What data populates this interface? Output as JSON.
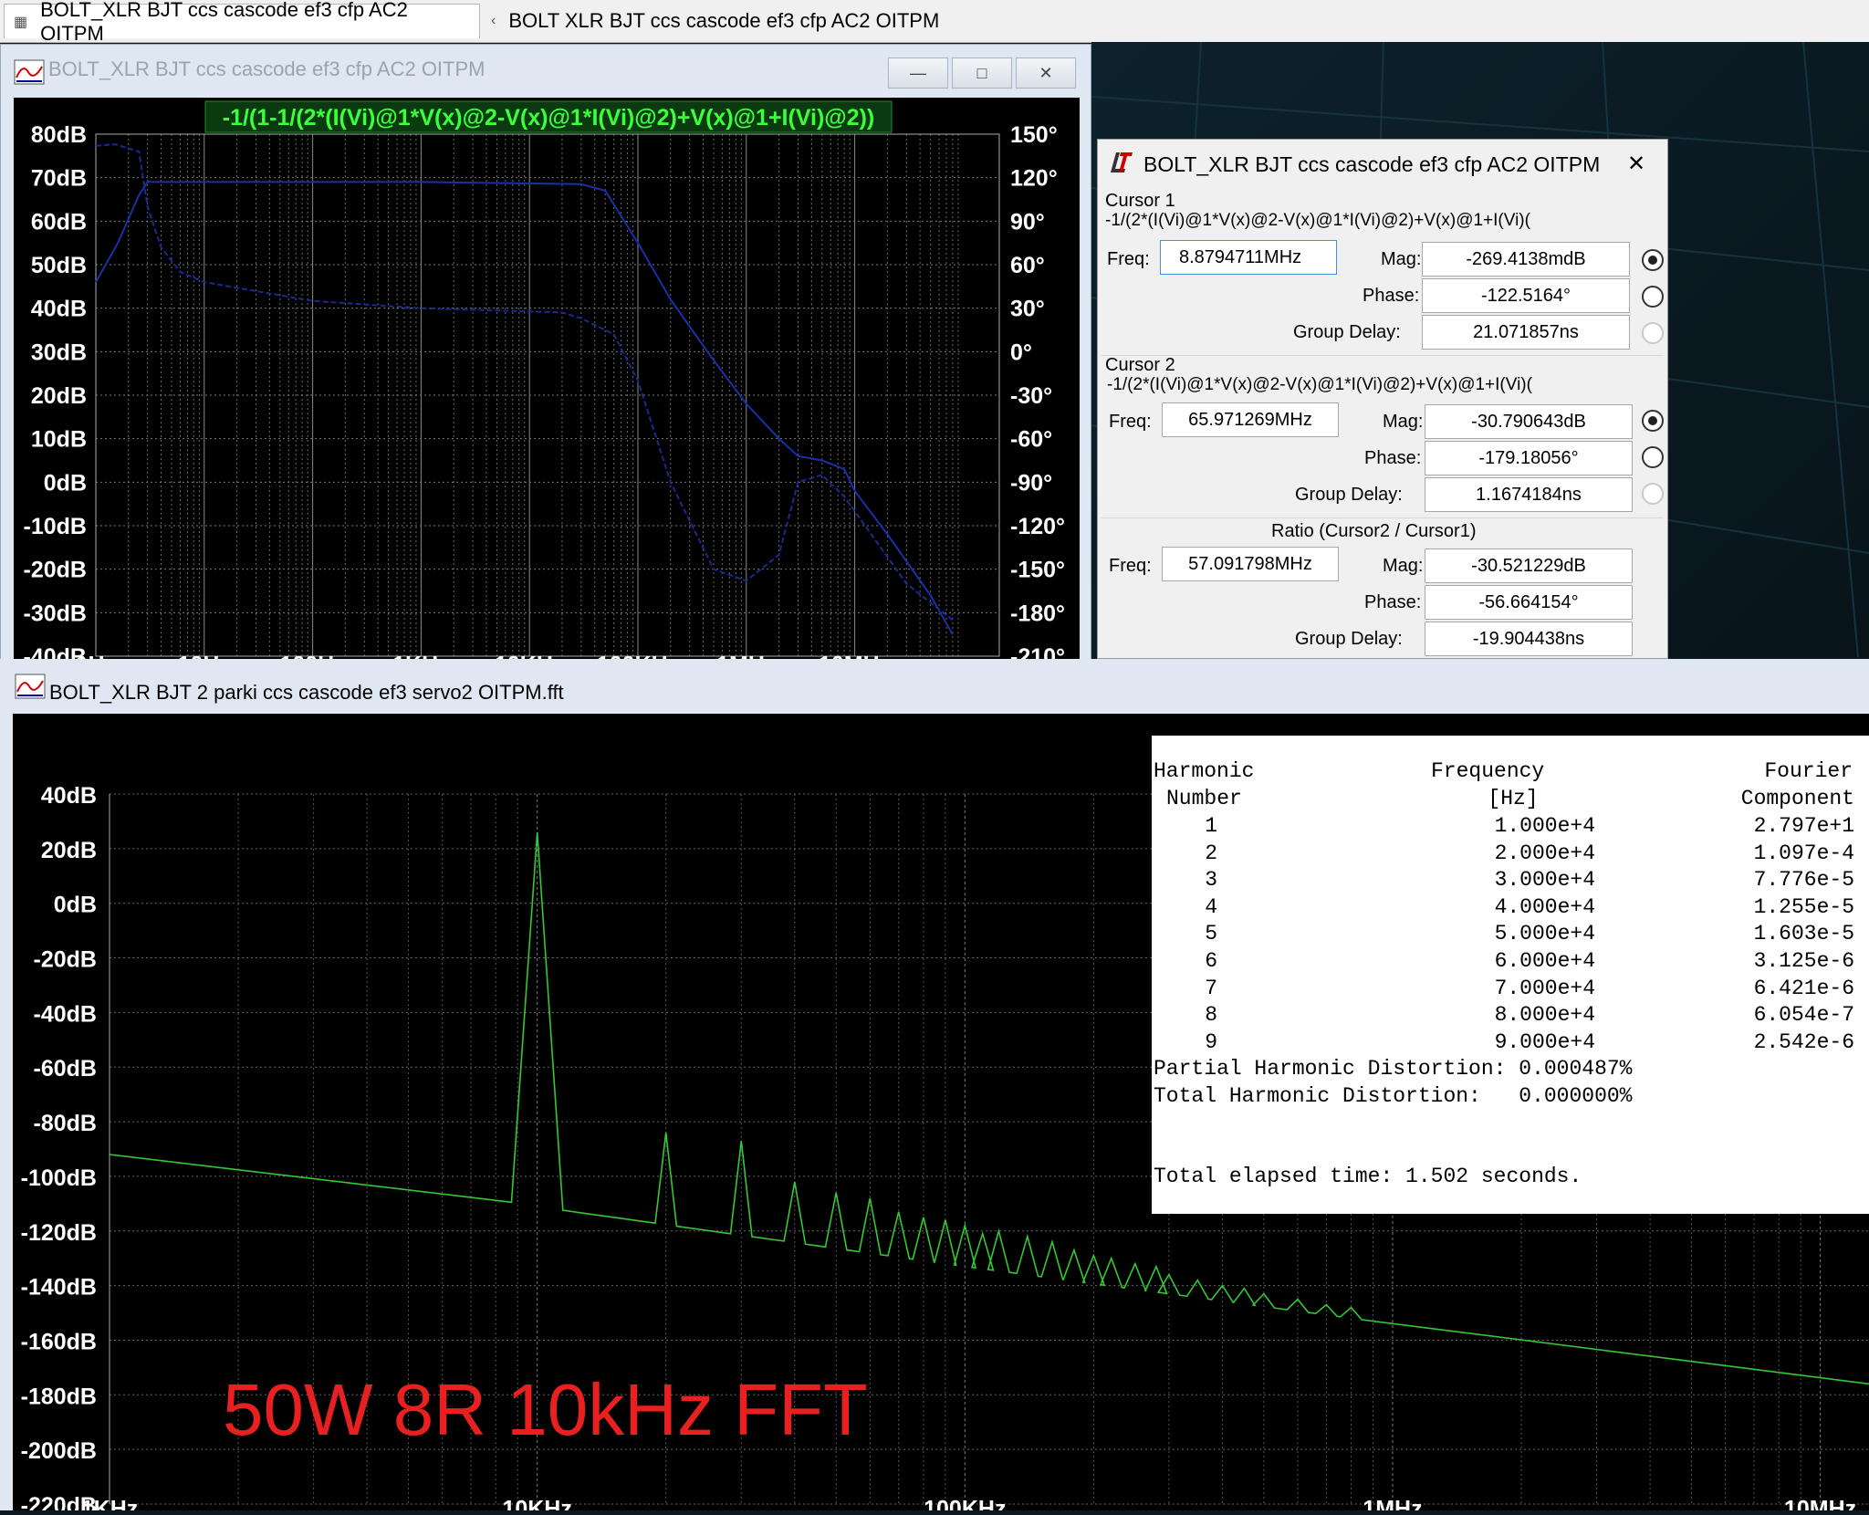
{
  "tabs": [
    {
      "label": "BOLT_XLR BJT ccs cascode ef3 cfp AC2 OITPM"
    },
    {
      "label": "BOLT  XLR BJT ccs cascode ef3 cfp AC2 OITPM"
    }
  ],
  "ac_window": {
    "title": "BOLT_XLR BJT ccs cascode ef3 cfp AC2 OITPM",
    "trace_expr": "-1/(1-1/(2*(I(Vi)@1*V(x)@2-V(x)@1*I(Vi)@2)+V(x)@1+I(Vi)@2))",
    "buttons": {
      "minimize": "—",
      "maximize": "□",
      "close": "✕"
    }
  },
  "cursor_dialog": {
    "title": "BOLT_XLR BJT ccs cascode ef3 cfp AC2 OITPM",
    "close": "✕",
    "cursor1": {
      "label": "Cursor 1",
      "expr": "-1/(2*(I(Vi)@1*V(x)@2-V(x)@1*I(Vi)@2)+V(x)@1+I(Vi)(",
      "freq_label": "Freq:",
      "freq": "8.8794711MHz",
      "mag_label": "Mag:",
      "mag": "-269.4138mdB",
      "phase_label": "Phase:",
      "phase": "-122.5164°",
      "gd_label": "Group Delay:",
      "gd": "21.071857ns"
    },
    "cursor2": {
      "label": "Cursor 2",
      "expr": "-1/(2*(I(Vi)@1*V(x)@2-V(x)@1*I(Vi)@2)+V(x)@1+I(Vi)(",
      "freq_label": "Freq:",
      "freq": "65.971269MHz",
      "mag_label": "Mag:",
      "mag": "-30.790643dB",
      "phase_label": "Phase:",
      "phase": "-179.18056°",
      "gd_label": "Group Delay:",
      "gd": "1.1674184ns"
    },
    "ratio": {
      "label": "Ratio (Cursor2 / Cursor1)",
      "freq_label": "Freq:",
      "freq": "57.091798MHz",
      "mag_label": "Mag:",
      "mag": "-30.521229dB",
      "phase_label": "Phase:",
      "phase": "-56.664154°",
      "gd_label": "Group Delay:",
      "gd": "-19.904438ns"
    }
  },
  "fft_window": {
    "title": "BOLT_XLR BJT 2 parki ccs cascode ef3 servo2 OITPM.fft",
    "trace_label": "V(vout)",
    "annotation": "50W 8R 10kHz FFT"
  },
  "fourier": {
    "headers": {
      "harmonic": [
        "Harmonic",
        "Number"
      ],
      "frequency": [
        "Frequency",
        "[Hz]"
      ],
      "component": [
        "Fourier",
        "Component"
      ]
    },
    "rows": [
      {
        "n": "1",
        "f": "1.000e+4",
        "c": "2.797e+1"
      },
      {
        "n": "2",
        "f": "2.000e+4",
        "c": "1.097e-4"
      },
      {
        "n": "3",
        "f": "3.000e+4",
        "c": "7.776e-5"
      },
      {
        "n": "4",
        "f": "4.000e+4",
        "c": "1.255e-5"
      },
      {
        "n": "5",
        "f": "5.000e+4",
        "c": "1.603e-5"
      },
      {
        "n": "6",
        "f": "6.000e+4",
        "c": "3.125e-6"
      },
      {
        "n": "7",
        "f": "7.000e+4",
        "c": "6.421e-6"
      },
      {
        "n": "8",
        "f": "8.000e+4",
        "c": "6.054e-7"
      },
      {
        "n": "9",
        "f": "9.000e+4",
        "c": "2.542e-6"
      }
    ],
    "phd": "Partial Harmonic Distortion: 0.000487%",
    "thd": "Total Harmonic Distortion:   0.000000%",
    "elapsed": "Total elapsed time: 1.502 seconds."
  },
  "chart_data": [
    {
      "type": "line",
      "xscale": "log",
      "x_ticks": [
        "1Hz",
        "10Hz",
        "100Hz",
        "1KHz",
        "10KHz",
        "100KHz",
        "1MHz",
        "10MHz"
      ],
      "xlim_hz": [
        1,
        100000000
      ],
      "y_left_ticks": [
        "80dB",
        "70dB",
        "60dB",
        "50dB",
        "40dB",
        "30dB",
        "20dB",
        "10dB",
        "0dB",
        "-10dB",
        "-20dB",
        "-30dB",
        "-40dB"
      ],
      "y_right_ticks": [
        "150°",
        "120°",
        "90°",
        "60°",
        "30°",
        "0°",
        "-30°",
        "-60°",
        "-90°",
        "-120°",
        "-150°",
        "-180°",
        "-210°"
      ],
      "ylim_db": [
        -40,
        80
      ],
      "ylim_deg": [
        -210,
        150
      ],
      "grid": true,
      "series": [
        {
          "name": "-1/(1-1/(2*(I(Vi)@1*V(x)@2-V(x)@1*I(Vi)@2)+V(x)@1+I(Vi)@2))",
          "unit": "dB",
          "points": [
            [
              1,
              46
            ],
            [
              1.6,
              55
            ],
            [
              2.5,
              66
            ],
            [
              3,
              69
            ],
            [
              4,
              69
            ],
            [
              10,
              69
            ],
            [
              1000,
              69
            ],
            [
              30000,
              68.5
            ],
            [
              50000,
              67
            ],
            [
              100000,
              55
            ],
            [
              200000,
              42
            ],
            [
              500000,
              28
            ],
            [
              1000000,
              18
            ],
            [
              2000000,
              10
            ],
            [
              3000000,
              6
            ],
            [
              5000000,
              5
            ],
            [
              8000000,
              3
            ],
            [
              10000000,
              -2
            ],
            [
              20000000,
              -12
            ],
            [
              50000000,
              -26
            ],
            [
              80000000,
              -35
            ]
          ]
        },
        {
          "name": "-1/(1-1/(2*(I(Vi)@1*V(x)@2-V(x)@1*I(Vi)@2)+V(x)@1+I(Vi)@2))",
          "unit": "deg",
          "points": [
            [
              1,
              142
            ],
            [
              1.5,
              143
            ],
            [
              2.5,
              138
            ],
            [
              3,
              100
            ],
            [
              4,
              72
            ],
            [
              6,
              55
            ],
            [
              10,
              48
            ],
            [
              100,
              35
            ],
            [
              1000,
              30
            ],
            [
              20000,
              27
            ],
            [
              30000,
              23
            ],
            [
              60000,
              12
            ],
            [
              100000,
              -20
            ],
            [
              200000,
              -90
            ],
            [
              500000,
              -150
            ],
            [
              1000000,
              -158
            ],
            [
              2000000,
              -140
            ],
            [
              3000000,
              -90
            ],
            [
              5000000,
              -85
            ],
            [
              8000000,
              -100
            ],
            [
              10000000,
              -110
            ],
            [
              30000000,
              -160
            ],
            [
              80000000,
              -185
            ]
          ]
        }
      ]
    },
    {
      "type": "line",
      "xscale": "log",
      "x_ticks": [
        "1KHz",
        "10KHz",
        "100KHz",
        "1MHz",
        "10MHz"
      ],
      "xlim_hz": [
        1000,
        13000000
      ],
      "y_ticks": [
        "40dB",
        "20dB",
        "0dB",
        "-20dB",
        "-40dB",
        "-60dB",
        "-80dB",
        "-100dB",
        "-120dB",
        "-140dB",
        "-160dB",
        "-180dB",
        "-200dB",
        "-220dB"
      ],
      "ylim_db": [
        -220,
        40
      ],
      "grid": true,
      "series": [
        {
          "name": "V(vout)",
          "floor_points": [
            [
              1000,
              -92
            ],
            [
              9300,
              -110
            ],
            [
              11000,
              -112
            ],
            [
              100000,
              -133
            ],
            [
              1000000,
              -154
            ],
            [
              13000000,
              -176
            ]
          ],
          "peaks": [
            [
              10000,
              26
            ],
            [
              20000,
              -84
            ],
            [
              30000,
              -87
            ],
            [
              40000,
              -102
            ],
            [
              50000,
              -106
            ],
            [
              60000,
              -108
            ],
            [
              70000,
              -113
            ],
            [
              80000,
              -115
            ],
            [
              90000,
              -116
            ],
            [
              100000,
              -118
            ],
            [
              110000,
              -121
            ],
            [
              120000,
              -120
            ],
            [
              140000,
              -122
            ],
            [
              160000,
              -124
            ],
            [
              180000,
              -127
            ],
            [
              200000,
              -129
            ],
            [
              220000,
              -130
            ],
            [
              250000,
              -132
            ],
            [
              280000,
              -133
            ],
            [
              300000,
              -136
            ],
            [
              350000,
              -138
            ],
            [
              400000,
              -140
            ],
            [
              450000,
              -141
            ],
            [
              500000,
              -143
            ],
            [
              600000,
              -145
            ],
            [
              700000,
              -147
            ],
            [
              800000,
              -148
            ]
          ]
        }
      ]
    }
  ]
}
